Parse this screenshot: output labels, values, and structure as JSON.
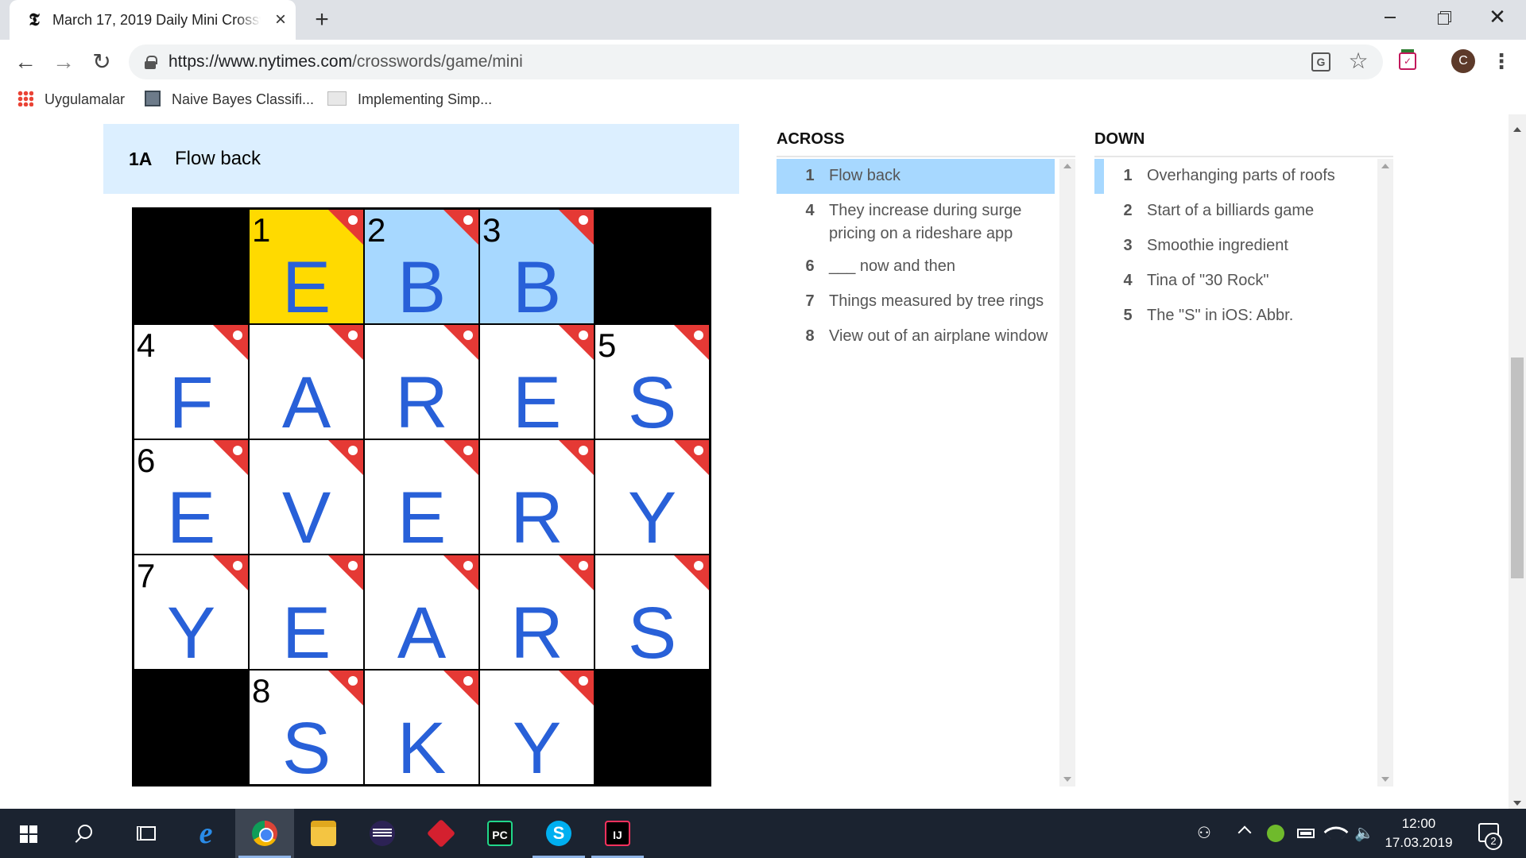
{
  "browser": {
    "tab_title": "March 17, 2019 Daily Mini Crossword Puzzle",
    "tab_favicon": "𝕿",
    "url_host": "https://www.nytimes.com",
    "url_path": "/crosswords/game/mini",
    "profile_initial": "C",
    "bookmarks": [
      {
        "label": "Uygulamalar",
        "icon": "apps-grid-icon"
      },
      {
        "label": "Naive Bayes Classifi...",
        "icon": "page-thumbnail-icon"
      },
      {
        "label": "Implementing Simp...",
        "icon": "page-thumbnail-icon"
      }
    ]
  },
  "clue_bar": {
    "number": "1A",
    "text": "Flow back"
  },
  "puzzle": {
    "rows": [
      [
        {
          "type": "black"
        },
        {
          "num": "1",
          "letter": "E",
          "state": "focus",
          "flag": true
        },
        {
          "num": "2",
          "letter": "B",
          "state": "highlight",
          "flag": true
        },
        {
          "num": "3",
          "letter": "B",
          "state": "highlight",
          "flag": true
        },
        {
          "type": "black"
        }
      ],
      [
        {
          "num": "4",
          "letter": "F",
          "flag": true
        },
        {
          "num": "",
          "letter": "A",
          "flag": true
        },
        {
          "num": "",
          "letter": "R",
          "flag": true
        },
        {
          "num": "",
          "letter": "E",
          "flag": true
        },
        {
          "num": "5",
          "letter": "S",
          "flag": true
        }
      ],
      [
        {
          "num": "6",
          "letter": "E",
          "flag": true
        },
        {
          "num": "",
          "letter": "V",
          "flag": true
        },
        {
          "num": "",
          "letter": "E",
          "flag": true
        },
        {
          "num": "",
          "letter": "R",
          "flag": true
        },
        {
          "num": "",
          "letter": "Y",
          "flag": true
        }
      ],
      [
        {
          "num": "7",
          "letter": "Y",
          "flag": true
        },
        {
          "num": "",
          "letter": "E",
          "flag": true
        },
        {
          "num": "",
          "letter": "A",
          "flag": true
        },
        {
          "num": "",
          "letter": "R",
          "flag": true
        },
        {
          "num": "",
          "letter": "S",
          "flag": true
        }
      ],
      [
        {
          "type": "black"
        },
        {
          "num": "8",
          "letter": "S",
          "flag": true
        },
        {
          "num": "",
          "letter": "K",
          "flag": true
        },
        {
          "num": "",
          "letter": "Y",
          "flag": true
        },
        {
          "type": "black"
        }
      ]
    ]
  },
  "across": {
    "title": "ACROSS",
    "clues": [
      {
        "num": "1",
        "text": "Flow back",
        "selected": true
      },
      {
        "num": "4",
        "text": "They increase during surge pricing on a rideshare app"
      },
      {
        "num": "6",
        "text": "___ now and then"
      },
      {
        "num": "7",
        "text": "Things measured by tree rings"
      },
      {
        "num": "8",
        "text": "View out of an airplane window"
      }
    ]
  },
  "down": {
    "title": "DOWN",
    "clues": [
      {
        "num": "1",
        "text": "Overhanging parts of roofs",
        "marked": true
      },
      {
        "num": "2",
        "text": "Start of a billiards game"
      },
      {
        "num": "3",
        "text": "Smoothie ingredient"
      },
      {
        "num": "4",
        "text": "Tina of \"30 Rock\""
      },
      {
        "num": "5",
        "text": "The \"S\" in iOS: Abbr."
      }
    ]
  },
  "taskbar": {
    "apps": [
      "start",
      "search",
      "task-view",
      "edge",
      "chrome",
      "file-explorer",
      "eclipse",
      "sourcetree",
      "pycharm",
      "skype",
      "intellij"
    ],
    "active_app": "chrome",
    "pycharm_label": "PC",
    "intellij_label": "IJ",
    "skype_label": "S",
    "edge_label": "e",
    "time": "12:00",
    "date": "17.03.2019",
    "notification_count": "2"
  },
  "colors": {
    "focus_cell": "#ffda00",
    "highlight_cell": "#a7d8ff",
    "letter": "#2860d8",
    "flag": "#e53935"
  }
}
